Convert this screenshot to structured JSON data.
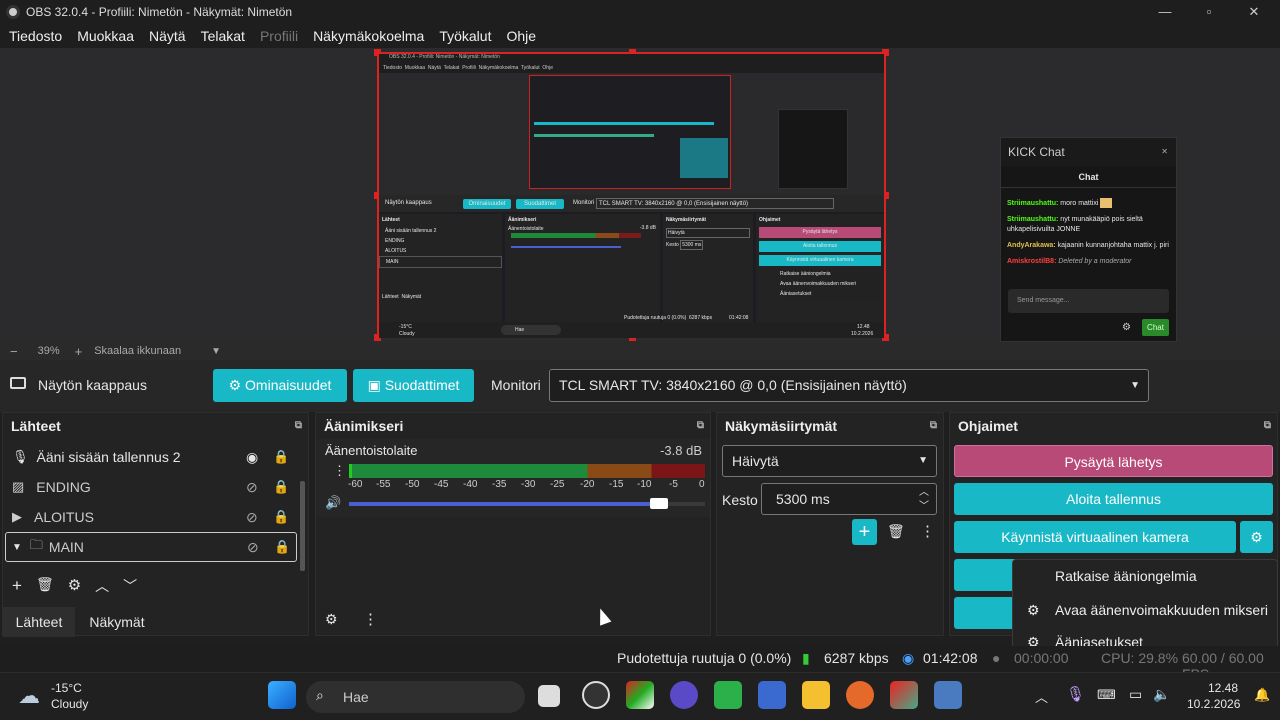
{
  "window": {
    "title": "OBS 32.0.4 - Profiili: Nimetön - Näkymät: Nimetön",
    "minimize": "—",
    "maximize": "▫",
    "close": "✕"
  },
  "menu": [
    "Tiedosto",
    "Muokkaa",
    "Näytä",
    "Telakat",
    "Profiili",
    "Näkymäkokoelma",
    "Työkalut",
    "Ohje"
  ],
  "kick_chat": {
    "window_title": "KICK Chat",
    "header": "Chat",
    "messages": [
      {
        "user": "Striimaushattu:",
        "text": "moro mattixi",
        "color": "#53fc18"
      },
      {
        "user": "Striimaushattu:",
        "text": "nyt munakääpiö pois sieltä uhkapelisivuilta JONNE",
        "color": "#53fc18"
      },
      {
        "user": "AndyArakawa:",
        "text": "kajaanin kunnanjohtaha mattix j. piri",
        "color": "#e0c050"
      },
      {
        "user": "AmiskrostilB8:",
        "text": "Deleted by a moderator",
        "color": "#ff4040"
      }
    ],
    "input_placeholder": "Send message...",
    "chat_button": "Chat"
  },
  "zoom": {
    "minus": "−",
    "level": "39%",
    "plus": "+",
    "scale_mode": "Skaalaa ikkunaan"
  },
  "source_bar": {
    "source_name": "Näytön kaappaus",
    "properties_label": "Ominaisuudet",
    "filters_label": "Suodattimet",
    "monitor_label": "Monitori",
    "monitor_value": "TCL SMART TV: 3840x2160 @ 0,0 (Ensisijainen näyttö)"
  },
  "sources": {
    "title": "Lähteet",
    "items": [
      {
        "name": "Ääni sisään tallennus 2"
      },
      {
        "name": "ENDING"
      },
      {
        "name": "ALOITUS"
      },
      {
        "name": "MAIN"
      }
    ],
    "tab_sources": "Lähteet",
    "tab_scenes": "Näkymät"
  },
  "mixer": {
    "title": "Äänimikseri",
    "channel": "Äänentoistolaite",
    "db": "-3.8 dB",
    "ticks": [
      "-60",
      "-55",
      "-50",
      "-45",
      "-40",
      "-35",
      "-30",
      "-25",
      "-20",
      "-15",
      "-10",
      "-5",
      "0"
    ],
    "volume": 0.87
  },
  "transitions": {
    "title": "Näkymäsiirtymät",
    "transition": "Häivytä",
    "duration_label": "Kesto",
    "duration": "5300 ms"
  },
  "controls": {
    "title": "Ohjaimet",
    "stop_stream": "Pysäytä lähetys",
    "start_recording": "Aloita tallennus",
    "virtual_camera": "Käynnistä virtuaalinen kamera"
  },
  "context_menu": {
    "items": [
      "Ratkaise ääniongelmia",
      "Avaa äänenvoimakkuuden mikseri",
      "Ääniasetukset"
    ]
  },
  "status": {
    "dropped": "Pudotettuja ruutuja 0 (0.0%)",
    "bitrate": "6287 kbps",
    "stream_time": "01:42:08",
    "rec_time": "00:00:00",
    "cpu": "CPU: 29.8%",
    "fps": "60.00 / 60.00 FPS"
  },
  "taskbar": {
    "temp": "-15°C",
    "weather": "Cloudy",
    "search": "Hae",
    "time": "12.48",
    "date": "10.2.2026"
  },
  "mini_preview": {
    "title": "OBS 32.0.4 - Profiili: Nimetön - Näkymät: Nimetön",
    "source": "Näytön kaappaus",
    "sources_title": "Lähteet",
    "mixer_title": "Äänimikseri",
    "trans_title": "Näkymäsiirtymät",
    "ctrl_title": "Ohjaimet",
    "src_items": [
      "Ääni sisään tallennus 2",
      "ENDING",
      "ALOITUS",
      "MAIN"
    ],
    "ctrl_items": [
      "Pysäytä lähetys",
      "Aloita tallennus",
      "Käynnistä virtuaalinen kamera",
      "Ratkaise ääniongelmia",
      "Avaa äänenvoimakkuuden mikseri",
      "Ääniasetukset"
    ],
    "status": "Pudotettuja ruutuja 0 (0.0%)",
    "bitrate": "6287 kbps",
    "time": "01:42:08",
    "search": "Hae",
    "clock": "12.48",
    "date": "10.2.2026",
    "temp": "-15°C",
    "weather": "Cloudy",
    "zoom": "39%",
    "scale": "Skaalaa ikkunaan",
    "monitor": "TCL SMART TV: 3840x2160 @ 0,0 (Ensisijainen näyttö)",
    "transition": "Häivytä",
    "duration_label": "Kesto",
    "duration": "5300 ms",
    "channel": "Äänentoistolaite",
    "db": "-3.8 dB",
    "tab_sources": "Lähteet",
    "tab_scenes": "Näkymät",
    "monitor_label": "Monitori",
    "properties": "Ominaisuudet",
    "filters": "Suodattimet"
  },
  "colors": {
    "accent": "#19b8c6",
    "stop_stream": "#b84a78",
    "panel": "#232323"
  }
}
